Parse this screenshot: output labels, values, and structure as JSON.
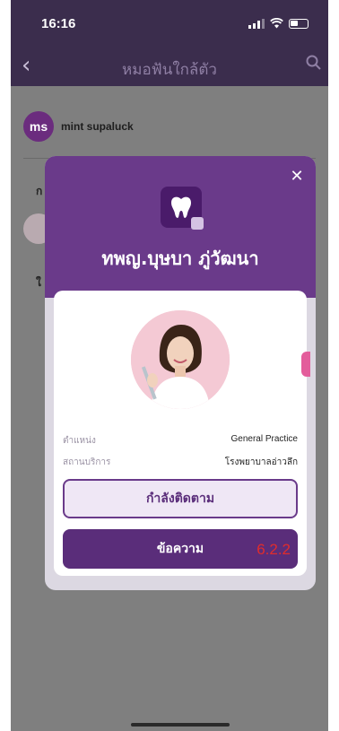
{
  "status_bar": {
    "time": "16:16"
  },
  "nav": {
    "title": "หมอฟันใกล้ตัว",
    "back_icon": "chevron-left-icon",
    "search_icon": "search-icon"
  },
  "background": {
    "user": {
      "initials": "ms",
      "name": "mint supaluck"
    },
    "fragments": [
      "ก",
      "ใ"
    ]
  },
  "modal": {
    "doctor_name": "ทพญ.บุษบา ภู่วัฒนา",
    "info": [
      {
        "label": "ตำแหน่ง",
        "value": "General Practice"
      },
      {
        "label": "สถานบริการ",
        "value": "โรงพยาบาลอ่าวลึก"
      }
    ],
    "follow_button": "กำลังติดตาม",
    "message_button": "ข้อความ",
    "version_tag": "6.2.2"
  },
  "colors": {
    "header_bg": "#3b2d4d",
    "modal_purple": "#6a3a8a",
    "button_purple": "#5a2d7a",
    "accent_red": "#e02c2c"
  }
}
